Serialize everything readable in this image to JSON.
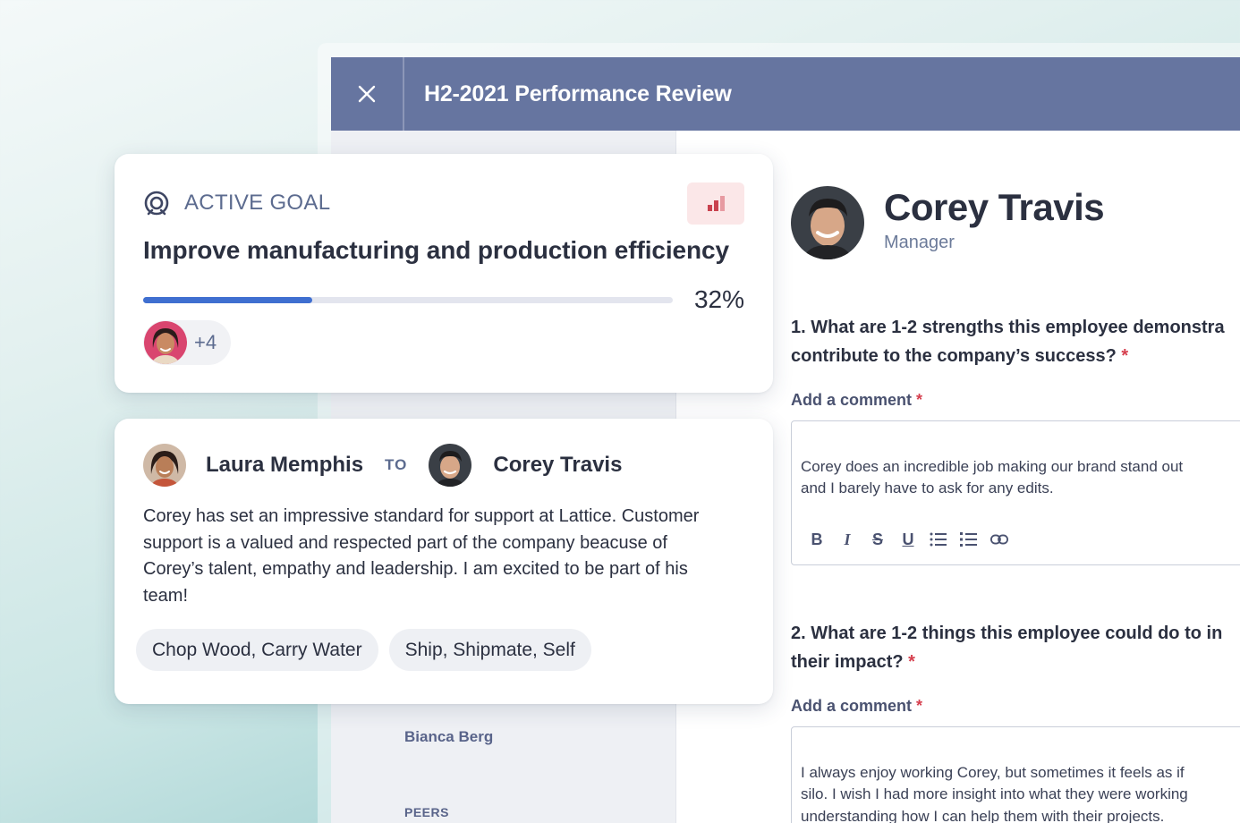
{
  "window": {
    "title": "H2-2021 Performance Review"
  },
  "sidebar": {
    "name": "Bianca Berg",
    "section": "PEERS"
  },
  "profile": {
    "name": "Corey Travis",
    "role": "Manager"
  },
  "questions": [
    {
      "line1": "1. What are 1-2 strengths this employee demonstra",
      "line2": "contribute to the company’s success?",
      "required_mark": "*",
      "comment_label": "Add a comment",
      "comment_text": "Corey does an incredible job making our brand stand out\nand I barely have to ask for any edits."
    },
    {
      "line1": "2. What are 1-2 things this employee could do to in",
      "line2": "their impact?",
      "required_mark": "*",
      "comment_label": "Add a comment",
      "comment_text": "I always enjoy working Corey, but sometimes it feels as if\nsilo. I wish I had more insight into what they were working\nunderstanding how I can help them with their projects."
    }
  ],
  "toolbar": {
    "bold": "B",
    "italic": "I",
    "strike": "S",
    "underline": "U"
  },
  "goal": {
    "label": "ACTIVE GOAL",
    "title": "Improve manufacturing and production efficiency",
    "progress": 32,
    "progress_label": "32%",
    "more_assignees": "+4"
  },
  "praise": {
    "from": "Laura Memphis",
    "to_label": "TO",
    "to": "Corey Travis",
    "body": "Corey has set an impressive standard for support at Lattice. Customer support is a valued and respected part of the company beacuse of Corey’s talent, empathy and leadership. I am excited to be part of his team!",
    "tags": [
      "Chop Wood, Carry Water",
      "Ship, Shipmate, Self"
    ]
  },
  "colors": {
    "header": "#6675a0",
    "progress": "#3f6fd0",
    "required": "#d6404f",
    "chart_icon": "#c9424f"
  }
}
